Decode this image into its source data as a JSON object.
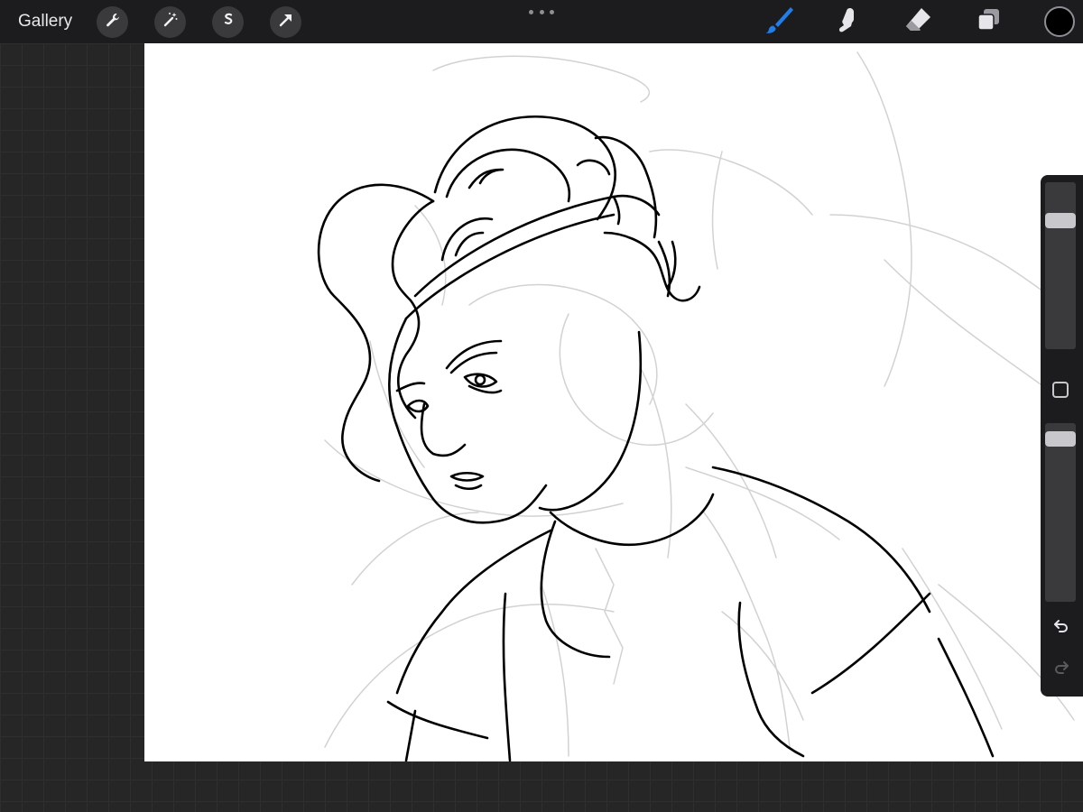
{
  "toolbar": {
    "gallery_label": "Gallery",
    "left_tools": [
      "wrench-icon",
      "magic-wand-icon",
      "selection-icon",
      "transform-arrow-icon"
    ],
    "more_icon": "more-dots-icon",
    "right_tools": [
      "brush-icon",
      "smudge-icon",
      "eraser-icon",
      "layers-icon"
    ],
    "active_tool": "brush-icon",
    "current_color": "#000000",
    "accent_color": "#1f7ee8"
  },
  "sidebar": {
    "brush_size_level": 0.8,
    "opacity_level": 0.95,
    "modify_icon": "square-icon",
    "undo_icon": "undo-icon",
    "redo_icon": "redo-icon"
  }
}
